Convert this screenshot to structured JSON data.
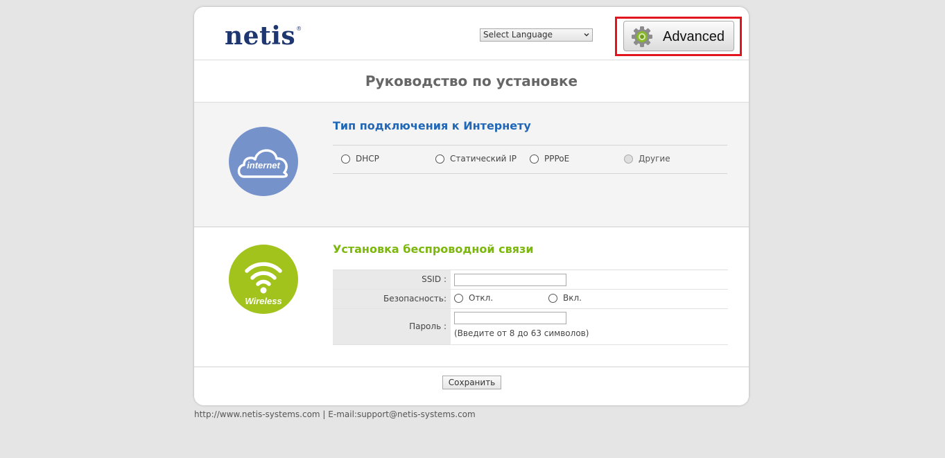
{
  "header": {
    "logo_text": "netis",
    "logo_mark": "®",
    "language_select": {
      "selected": "Select Language"
    },
    "advanced_button": {
      "label": "Advanced",
      "icon": "gear-icon"
    },
    "highlight_color": "#e2151f"
  },
  "page_title": "Руководство по установке",
  "internet_section": {
    "icon_label": "internet",
    "icon_color": "#7592cb",
    "title": "Тип подключения к Интернету",
    "title_color": "#2167b5",
    "options": [
      {
        "label": "DHCP",
        "disabled": false
      },
      {
        "label": "Статический IP",
        "disabled": false
      },
      {
        "label": "PPPoE",
        "disabled": false
      },
      {
        "label": "Другие",
        "disabled": true
      }
    ]
  },
  "wireless_section": {
    "icon_label": "Wireless",
    "icon_color": "#a1c31c",
    "title": "Установка беспроводной связи",
    "title_color": "#7cb70d",
    "ssid_label": "SSID :",
    "ssid_value": "",
    "security_label": "Безопасность:",
    "security_options": [
      "Откл.",
      "Вкл."
    ],
    "password_label": "Пароль :",
    "password_value": "",
    "password_hint": "(Введите от 8 до 63 символов)"
  },
  "save_button": {
    "label": "Сохранить"
  },
  "footer_text": "http://www.netis-systems.com | E-mail:support@netis-systems.com"
}
